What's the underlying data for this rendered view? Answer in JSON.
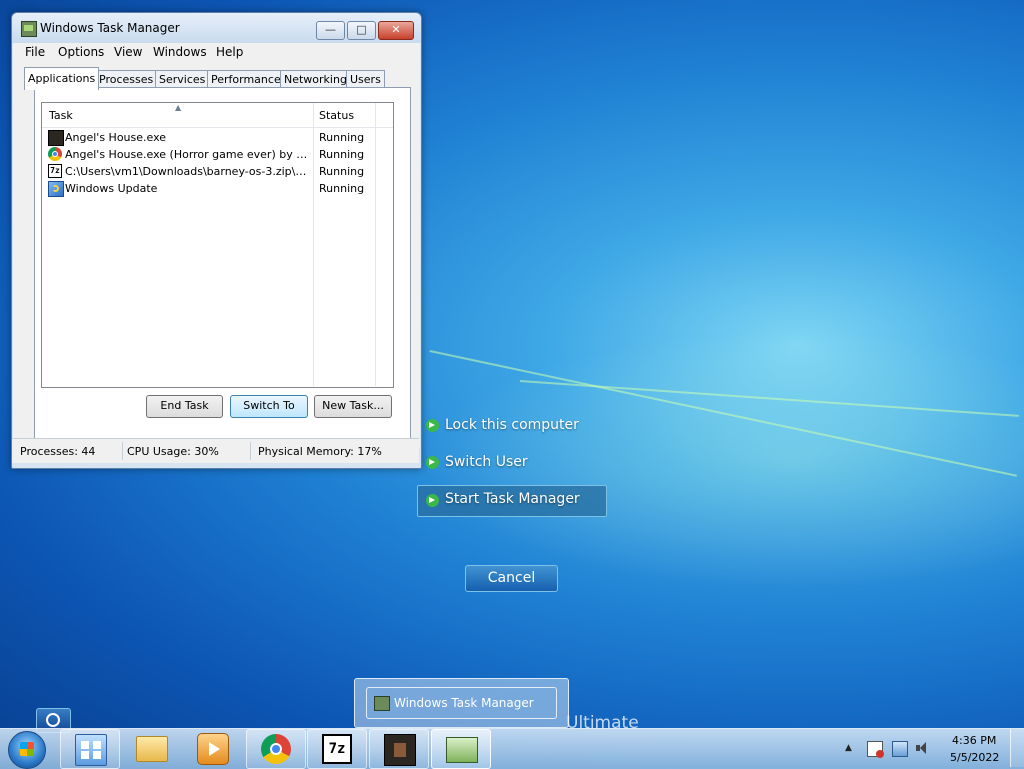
{
  "task_manager": {
    "title": "Windows Task Manager",
    "title_buttons": {
      "close": "✕"
    },
    "menu": [
      "File",
      "Options",
      "View",
      "Windows",
      "Help"
    ],
    "tabs": [
      "Applications",
      "Processes",
      "Services",
      "Performance",
      "Networking",
      "Users"
    ],
    "active_tab": "Applications",
    "columns": {
      "task": "Task",
      "status": "Status"
    },
    "rows": [
      {
        "task": "Angel's House.exe",
        "status": "Running",
        "icon": "game-icon"
      },
      {
        "task": "Angel's House.exe (Horror game ever) by New ...",
        "status": "Running",
        "icon": "chrome-icon"
      },
      {
        "task": "C:\\Users\\vm1\\Downloads\\barney-os-3.zip\\Barn...",
        "status": "Running",
        "icon": "7zip-icon"
      },
      {
        "task": "Windows Update",
        "status": "Running",
        "icon": "windows-update-icon"
      }
    ],
    "buttons": {
      "end_task": "End Task",
      "switch_to": "Switch To",
      "new_task": "New Task..."
    },
    "status_bar": {
      "processes": "Processes: 44",
      "cpu": "CPU Usage: 30%",
      "memory": "Physical Memory: 17%"
    }
  },
  "security_options": {
    "lock": "Lock this computer",
    "switch_user": "Switch User",
    "start_task_manager": "Start Task Manager",
    "selected": "Start Task Manager",
    "cancel": "Cancel"
  },
  "branding": {
    "edition_fragment": "Ultimate"
  },
  "taskbar": {
    "thumbnail_title": "Windows Task Manager",
    "pinned": [
      "control-panel-icon",
      "windows-explorer-icon",
      "media-player-icon",
      "chrome-icon",
      "7zip-icon",
      "game-icon",
      "task-manager-icon"
    ],
    "seven_zip_label": "7z",
    "clock": {
      "time": "4:36 PM",
      "date": "5/5/2022"
    }
  }
}
